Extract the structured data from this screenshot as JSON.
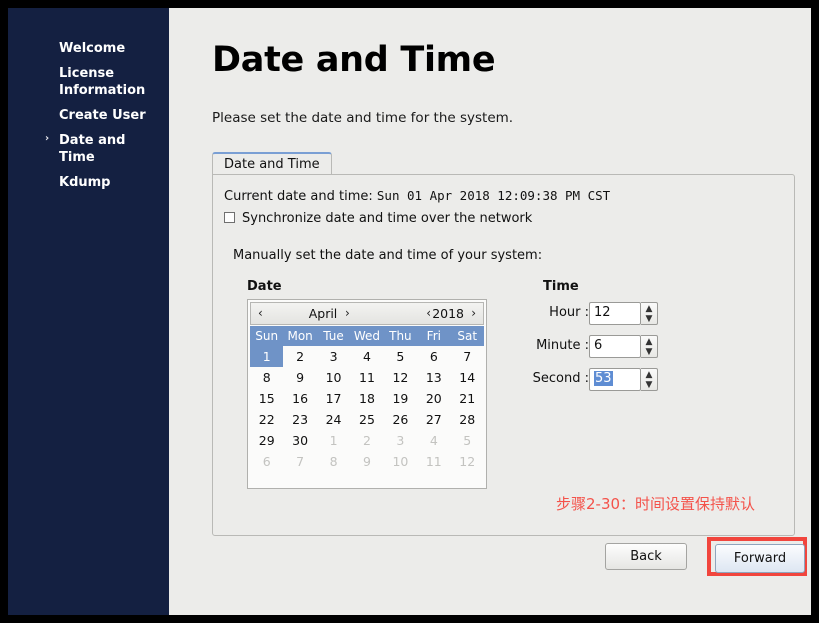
{
  "sidebar": {
    "items": [
      {
        "label": "Welcome",
        "active": false
      },
      {
        "label": "License Information",
        "active": false
      },
      {
        "label": "Create User",
        "active": false
      },
      {
        "label": "Date and Time",
        "active": true
      },
      {
        "label": "Kdump",
        "active": false
      }
    ],
    "active_marker": "›",
    "background_color": "#142041"
  },
  "page": {
    "title": "Date and Time",
    "subtitle": "Please set the date and time for the system."
  },
  "tab": {
    "label": "Date and Time"
  },
  "panel": {
    "current_label": "Current date and time:",
    "current_value": "Sun 01 Apr 2018 12:09:38 PM CST",
    "sync_checkbox_label": "Synchronize date and time over the network",
    "sync_checked": false,
    "manual_label": "Manually set the date and time of your system:"
  },
  "date_section": {
    "heading": "Date",
    "prev_month_icon": "‹",
    "month": "April",
    "next_month_icon": "›",
    "prev_year_icon": "‹",
    "year": "2018",
    "next_year_icon": "›",
    "day_headers": [
      "Sun",
      "Mon",
      "Tue",
      "Wed",
      "Thu",
      "Fri",
      "Sat"
    ],
    "selected_day": 1,
    "weeks": [
      [
        {
          "d": "1",
          "dim": false,
          "sel": true
        },
        {
          "d": "2",
          "dim": false,
          "sel": false
        },
        {
          "d": "3",
          "dim": false,
          "sel": false
        },
        {
          "d": "4",
          "dim": false,
          "sel": false
        },
        {
          "d": "5",
          "dim": false,
          "sel": false
        },
        {
          "d": "6",
          "dim": false,
          "sel": false
        },
        {
          "d": "7",
          "dim": false,
          "sel": false
        }
      ],
      [
        {
          "d": "8",
          "dim": false,
          "sel": false
        },
        {
          "d": "9",
          "dim": false,
          "sel": false
        },
        {
          "d": "10",
          "dim": false,
          "sel": false
        },
        {
          "d": "11",
          "dim": false,
          "sel": false
        },
        {
          "d": "12",
          "dim": false,
          "sel": false
        },
        {
          "d": "13",
          "dim": false,
          "sel": false
        },
        {
          "d": "14",
          "dim": false,
          "sel": false
        }
      ],
      [
        {
          "d": "15",
          "dim": false,
          "sel": false
        },
        {
          "d": "16",
          "dim": false,
          "sel": false
        },
        {
          "d": "17",
          "dim": false,
          "sel": false
        },
        {
          "d": "18",
          "dim": false,
          "sel": false
        },
        {
          "d": "19",
          "dim": false,
          "sel": false
        },
        {
          "d": "20",
          "dim": false,
          "sel": false
        },
        {
          "d": "21",
          "dim": false,
          "sel": false
        }
      ],
      [
        {
          "d": "22",
          "dim": false,
          "sel": false
        },
        {
          "d": "23",
          "dim": false,
          "sel": false
        },
        {
          "d": "24",
          "dim": false,
          "sel": false
        },
        {
          "d": "25",
          "dim": false,
          "sel": false
        },
        {
          "d": "26",
          "dim": false,
          "sel": false
        },
        {
          "d": "27",
          "dim": false,
          "sel": false
        },
        {
          "d": "28",
          "dim": false,
          "sel": false
        }
      ],
      [
        {
          "d": "29",
          "dim": false,
          "sel": false
        },
        {
          "d": "30",
          "dim": false,
          "sel": false
        },
        {
          "d": "1",
          "dim": true,
          "sel": false
        },
        {
          "d": "2",
          "dim": true,
          "sel": false
        },
        {
          "d": "3",
          "dim": true,
          "sel": false
        },
        {
          "d": "4",
          "dim": true,
          "sel": false
        },
        {
          "d": "5",
          "dim": true,
          "sel": false
        }
      ],
      [
        {
          "d": "6",
          "dim": true,
          "sel": false
        },
        {
          "d": "7",
          "dim": true,
          "sel": false
        },
        {
          "d": "8",
          "dim": true,
          "sel": false
        },
        {
          "d": "9",
          "dim": true,
          "sel": false
        },
        {
          "d": "10",
          "dim": true,
          "sel": false
        },
        {
          "d": "11",
          "dim": true,
          "sel": false
        },
        {
          "d": "12",
          "dim": true,
          "sel": false
        }
      ]
    ]
  },
  "time_section": {
    "heading": "Time",
    "fields": [
      {
        "label": "Hour :",
        "value": "12",
        "selected": false
      },
      {
        "label": "Minute :",
        "value": "6",
        "selected": false
      },
      {
        "label": "Second :",
        "value": "53",
        "selected": true
      }
    ],
    "up_icon": "▲",
    "down_icon": "▼"
  },
  "annotation": {
    "text": "步骤2-30：时间设置保持默认",
    "color": "#f4524a"
  },
  "footer": {
    "back_label": "Back",
    "forward_label": "Forward",
    "highlight_color": "#f1453d"
  }
}
